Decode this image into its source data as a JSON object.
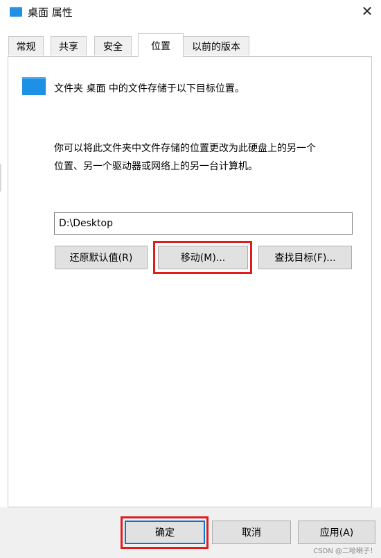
{
  "window": {
    "title": "桌面 属性",
    "close_glyph": "✕"
  },
  "tabs": [
    {
      "label": "常规",
      "active": false
    },
    {
      "label": "共享",
      "active": false
    },
    {
      "label": "安全",
      "active": false
    },
    {
      "label": "位置",
      "active": true
    },
    {
      "label": "以前的版本",
      "active": false
    }
  ],
  "location": {
    "info_text": "文件夹 桌面 中的文件存储于以下目标位置。",
    "description_line1": "你可以将此文件夹中文件存储的位置更改为此硬盘上的另一个",
    "description_line2": "位置、另一个驱动器或网络上的另一台计算机。",
    "path_value": "D:\\Desktop",
    "restore_button": "还原默认值(R)",
    "move_button": "移动(M)...",
    "find_target_button": "查找目标(F)..."
  },
  "footer": {
    "ok_button": "确定",
    "cancel_button": "取消",
    "apply_button": "应用(A)"
  },
  "watermark": "CSDN @二哈喇子！",
  "colors": {
    "highlight": "#e21b1b",
    "folder_icon": "#1e90e6",
    "focus": "#0078d7"
  },
  "icons": {
    "title": "folder-icon",
    "content": "folder-icon",
    "close": "close-icon"
  }
}
